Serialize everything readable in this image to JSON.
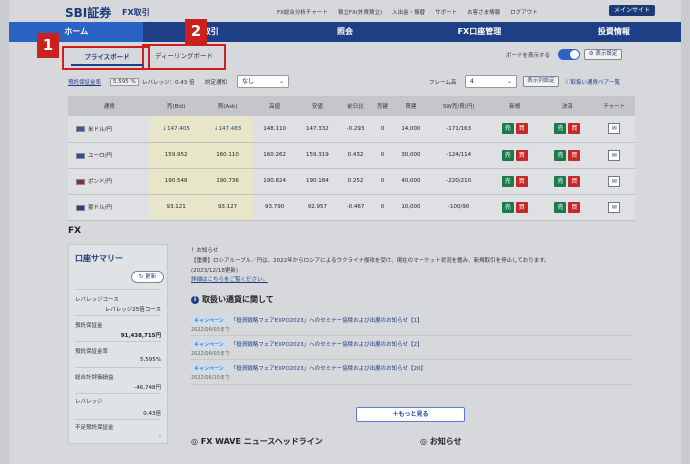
{
  "header": {
    "logo": "SBI証券",
    "logo_sub": "FX取引",
    "links": [
      "FX総合分析チャート",
      "積立FX(外貨積立)",
      "入出金・振替",
      "サポート",
      "お客さま情報",
      "ログアウト"
    ],
    "main_site": "メインサイト"
  },
  "nav": [
    "ホーム",
    "取引",
    "照会",
    "FX口座管理",
    "投資情報"
  ],
  "markers": [
    "1",
    "2"
  ],
  "tabs": {
    "price_board": "プライスボード",
    "dealing_board": "ディーリングボード"
  },
  "board_toggle": {
    "label": "ボードを表示する",
    "display_settings": "表示設定"
  },
  "controls": {
    "margin_rate_label": "預託保証金率",
    "margin_rate_value": "5,595 %",
    "leverage_label": "レバレッジ：0.43 倍",
    "order_notice_label": "約定通知",
    "order_notice_value": "なし",
    "frame_label": "フレーム高",
    "frame_value": "4",
    "columns_btn": "表示列設定",
    "pairs_list": "取扱い通貨ペア一覧"
  },
  "table": {
    "headers": [
      "通貨",
      "売(Bid)",
      "買(Ask)",
      "高値",
      "安値",
      "前日比",
      "売建",
      "買建",
      "SW売/買(円)",
      "新規",
      "決済",
      "チャート"
    ],
    "rows": [
      {
        "pair": "米ドル/円",
        "bid": "147.405",
        "ask": "147.483",
        "high": "148.110",
        "low": "147.332",
        "change": "-0.293",
        "sell": "0",
        "buy": "14,000",
        "swap": "-171/163",
        "new_b": "売",
        "new_s": "買",
        "set_b": "売",
        "set_s": "買",
        "trend": "down"
      },
      {
        "pair": "ユーロ/円",
        "bid": "159.952",
        "ask": "160.110",
        "high": "160.262",
        "low": "159.319",
        "change": "0.432",
        "sell": "0",
        "buy": "30,000",
        "swap": "-124/114",
        "new_b": "売",
        "new_s": "買",
        "set_b": "売",
        "set_s": "買",
        "trend": ""
      },
      {
        "pair": "ポンド/円",
        "bid": "190.548",
        "ask": "190.736",
        "high": "190.824",
        "low": "190.184",
        "change": "0.252",
        "sell": "0",
        "buy": "40,000",
        "swap": "-220/210",
        "new_b": "売",
        "new_s": "買",
        "set_b": "売",
        "set_s": "買",
        "trend": ""
      },
      {
        "pair": "豪ドル/円",
        "bid": "93.121",
        "ask": "93.127",
        "high": "93.790",
        "low": "92.957",
        "change": "-0.467",
        "sell": "0",
        "buy": "10,000",
        "swap": "-100/90",
        "new_b": "売",
        "new_s": "買",
        "set_b": "売",
        "set_s": "買",
        "trend": ""
      }
    ]
  },
  "fx_label": "FX",
  "summary": {
    "title": "口座サマリー",
    "update": "更新",
    "leverage_course_label": "レバレッジコース",
    "leverage_course_value": "レバレッジ25倍コース",
    "margin_label": "預託保証金",
    "margin_value": "91,438,715円",
    "margin_rate_label": "預託保証金率",
    "margin_rate_value": "5,595%",
    "pl_label": "総合計評価損益",
    "pl_value": "-46,748円",
    "leverage_label": "レバレッジ",
    "leverage_value": "0.43倍",
    "shortfall_label": "不足預託保証金",
    "shortfall_value": "-"
  },
  "notice": {
    "title": "！お知らせ",
    "body": "【重要】ロシアルーブル／円は、2022年からロシアによるウクライナ侵攻を受け、現在のマーケット状況を鑑み、新規取引を停止しております。",
    "date": "(2023/12/18更新)",
    "link": "詳細はこちらをご覧ください。"
  },
  "section_title": "取扱い通貨に関して",
  "news": [
    {
      "badge": "キャンペーン",
      "text": "「投資戦略フェアEXPO2023」へのセミナー協賛および出展のお知らせ【1】",
      "date": "2022/06/03まで"
    },
    {
      "badge": "キャンペーン",
      "text": "「投資戦略フェアEXPO2023」へのセミナー協賛および出展のお知らせ【2】",
      "date": "2022/06/03まで"
    },
    {
      "badge": "キャンペーン",
      "text": "「投資戦略フェアEXPO2023」へのセミナー協賛および出展のお知らせ【20】",
      "date": "2022/06/10まで"
    }
  ],
  "more_button": "もっと見る",
  "footer": {
    "news_headline": "FX WAVE ニュースヘッドライン",
    "notices": "お知らせ"
  }
}
